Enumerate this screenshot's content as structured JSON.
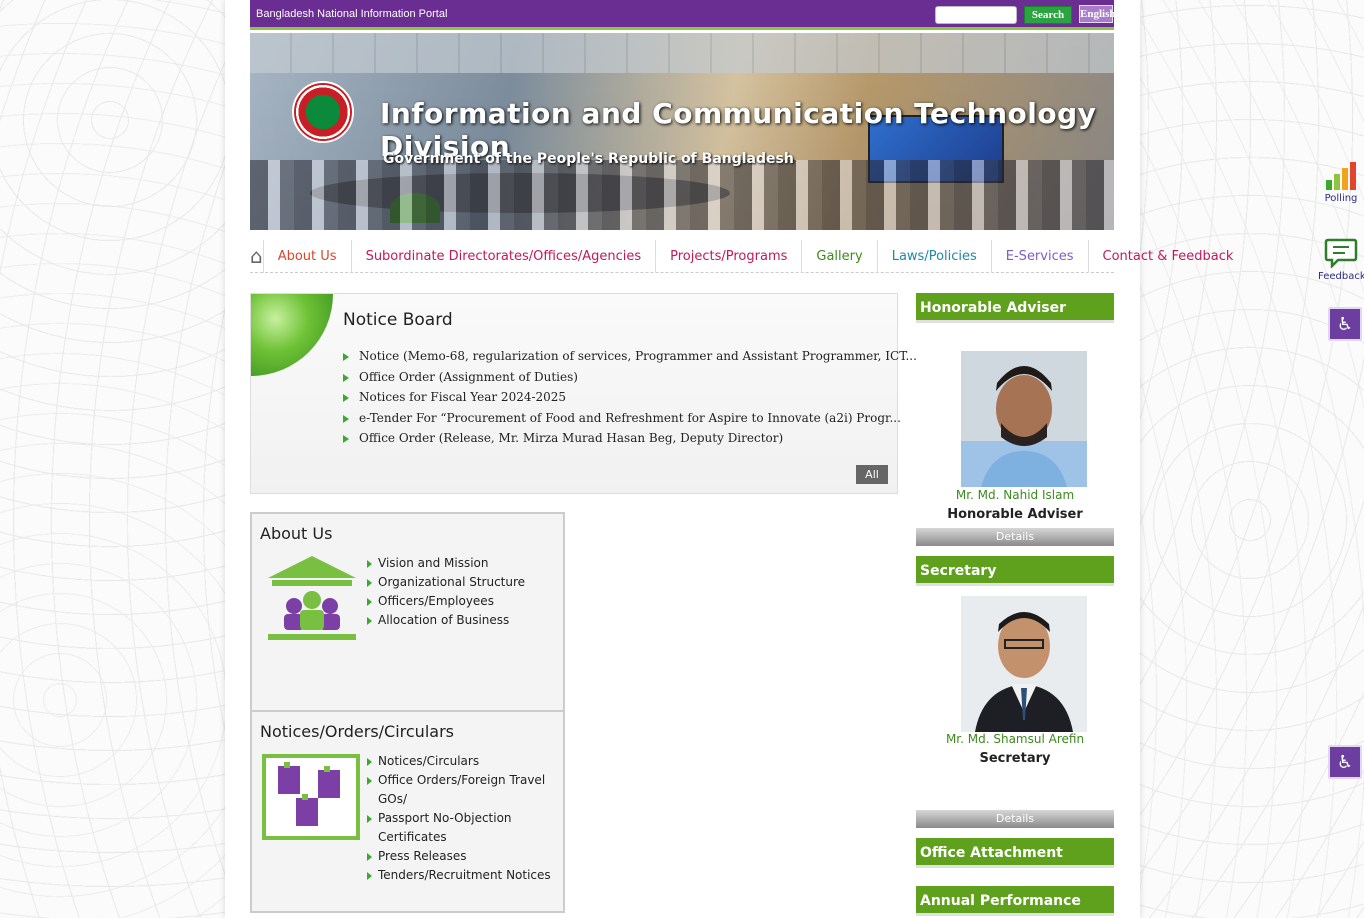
{
  "topbar": {
    "portal_label": "Bangladesh National Information Portal",
    "search_placeholder": "",
    "search_button": "Search",
    "language_button": "English"
  },
  "banner": {
    "title": "Information and Communication Technology Division",
    "subtitle": "Government of the People's Republic of Bangladesh"
  },
  "nav": {
    "items": [
      {
        "label": "About Us",
        "color": "#d9452c"
      },
      {
        "label": "Subordinate Directorates/Offices/Agencies",
        "color": "#c2185b"
      },
      {
        "label": "Projects/Programs",
        "color": "#c2185b"
      },
      {
        "label": "Gallery",
        "color": "#3c8a1e"
      },
      {
        "label": "Laws/Policies",
        "color": "#1e88a8"
      },
      {
        "label": "E-Services",
        "color": "#7b5fc4"
      },
      {
        "label": "Contact & Feedback",
        "color": "#c2185b"
      }
    ]
  },
  "notice_board": {
    "title": "Notice Board",
    "items": [
      "Notice (Memo-68, regularization of services, Programmer and Assistant Programmer, ICT...",
      "Office Order (Assignment of Duties)",
      "Notices for Fiscal Year 2024-2025",
      "e-Tender For “Procurement of Food and Refreshment for Aspire to Innovate (a2i) Progr...",
      "Office Order (Release, Mr. Mirza Murad Hasan Beg, Deputy Director)"
    ],
    "all_button": "All"
  },
  "about": {
    "title": "About Us",
    "items": [
      "Vision and Mission",
      "Organizational Structure",
      "Officers/Employees",
      "Allocation of Business"
    ]
  },
  "notices": {
    "title": "Notices/Orders/Circulars",
    "items": [
      "Notices/Circulars",
      "Office Orders/Foreign Travel GOs/",
      "Passport No-Objection Certificates",
      "Press Releases",
      "Tenders/Recruitment Notices"
    ]
  },
  "sidebar": {
    "adviser_head": "Honorable Adviser",
    "adviser_name": "Mr. Md. Nahid Islam",
    "adviser_role": "Honorable Adviser",
    "secretary_head": "Secretary",
    "secretary_name": "Mr. Md. Shamsul Arefin",
    "secretary_role": "Secretary",
    "details_label": "Details",
    "form_head": "Office Attachment Application Form",
    "apa_head": "Annual Performance Agreement (APA)"
  },
  "widgets": {
    "polling_label": "Polling",
    "feedback_label": "Feedback"
  },
  "colors": {
    "topbar": "#6a2d91",
    "accent_green": "#5fa11d",
    "search_button": "#2aa340"
  }
}
